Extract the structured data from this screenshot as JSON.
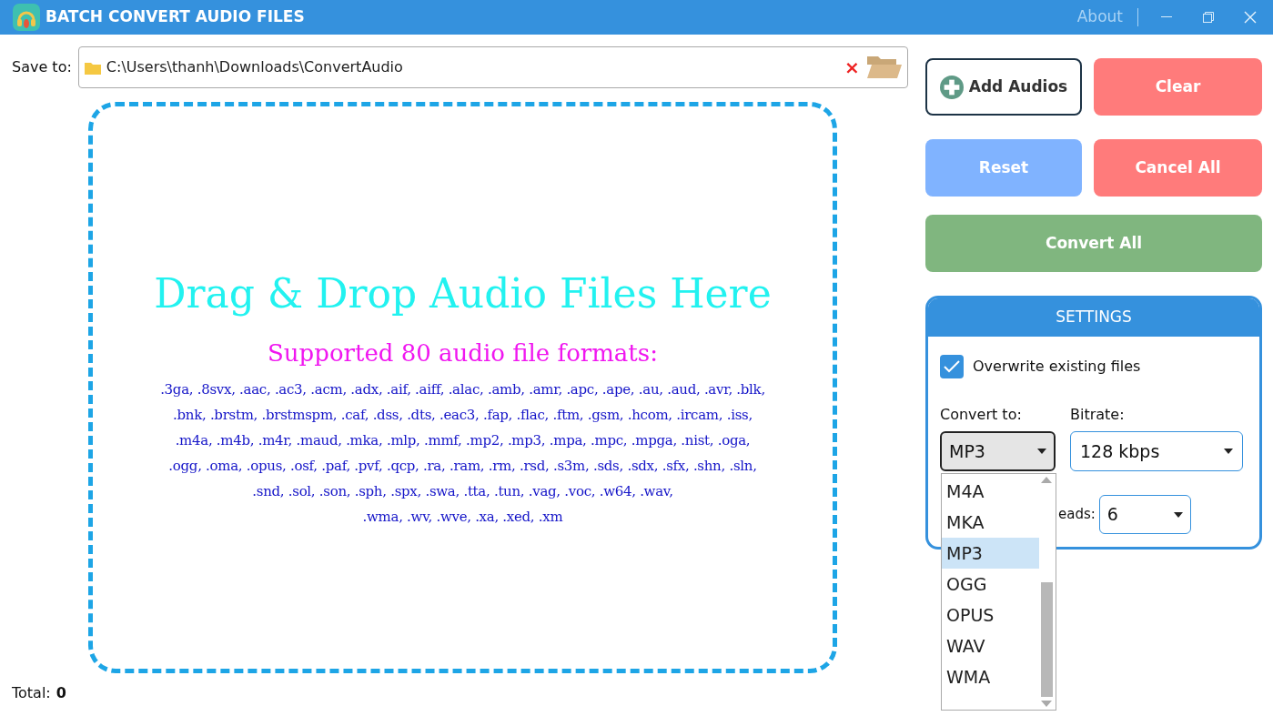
{
  "window": {
    "title": "BATCH CONVERT AUDIO FILES",
    "about": "About"
  },
  "save_to": {
    "label": "Save to:",
    "value": "C:\\Users\\thanh\\Downloads\\ConvertAudio",
    "clear": "×"
  },
  "drop_zone": {
    "headline": "Drag & Drop Audio Files Here",
    "subtitle": "Supported 80 audio file formats:",
    "formats": [
      ".3ga, .8svx, .aac, .ac3, .acm, .adx, .aif, .aiff, .alac, .amb, .amr, .apc, .ape, .au, .aud, .avr, .blk,",
      ".bnk, .brstm, .brstmspm, .caf, .dss, .dts, .eac3, .fap, .flac, .ftm, .gsm, .hcom, .ircam, .iss,",
      ".m4a, .m4b, .m4r, .maud, .mka, .mlp, .mmf, .mp2, .mp3, .mpa, .mpc, .mpga, .nist, .oga,",
      ".ogg, .oma, .opus, .osf, .paf, .pvf, .qcp, .ra, .ram, .rm, .rsd, .s3m, .sds, .sdx, .sfx, .shn, .sln,",
      ".snd, .sol, .son, .sph, .spx, .swa, .tta, .tun, .vag, .voc, .w64, .wav,",
      ".wma, .wv, .wve, .xa, .xed, .xm"
    ]
  },
  "buttons": [
    {
      "kind": "add",
      "label": "Add Audios"
    },
    {
      "kind": "clear",
      "label": "Clear"
    },
    {
      "kind": "reset",
      "label": "Reset"
    },
    {
      "kind": "cancel",
      "label": "Cancel All"
    },
    {
      "kind": "convert",
      "label": "Convert All"
    }
  ],
  "settings": {
    "title": "SETTINGS",
    "overwrite": {
      "label": "Overwrite existing files",
      "checked": true
    },
    "convert_to": {
      "label": "Convert to:",
      "value": "MP3",
      "options": [
        {
          "label": "M4A",
          "selected": false
        },
        {
          "label": "MKA",
          "selected": false
        },
        {
          "label": "MP3",
          "selected": true
        },
        {
          "label": "OGG",
          "selected": false
        },
        {
          "label": "OPUS",
          "selected": false
        },
        {
          "label": "WAV",
          "selected": false
        },
        {
          "label": "WMA",
          "selected": false
        }
      ]
    },
    "bitrate": {
      "label": "Bitrate:",
      "value": "128 kbps"
    },
    "threads": {
      "label": "eads:",
      "value": "6"
    }
  },
  "status_bar": {
    "label": "Total:",
    "value": "0"
  }
}
